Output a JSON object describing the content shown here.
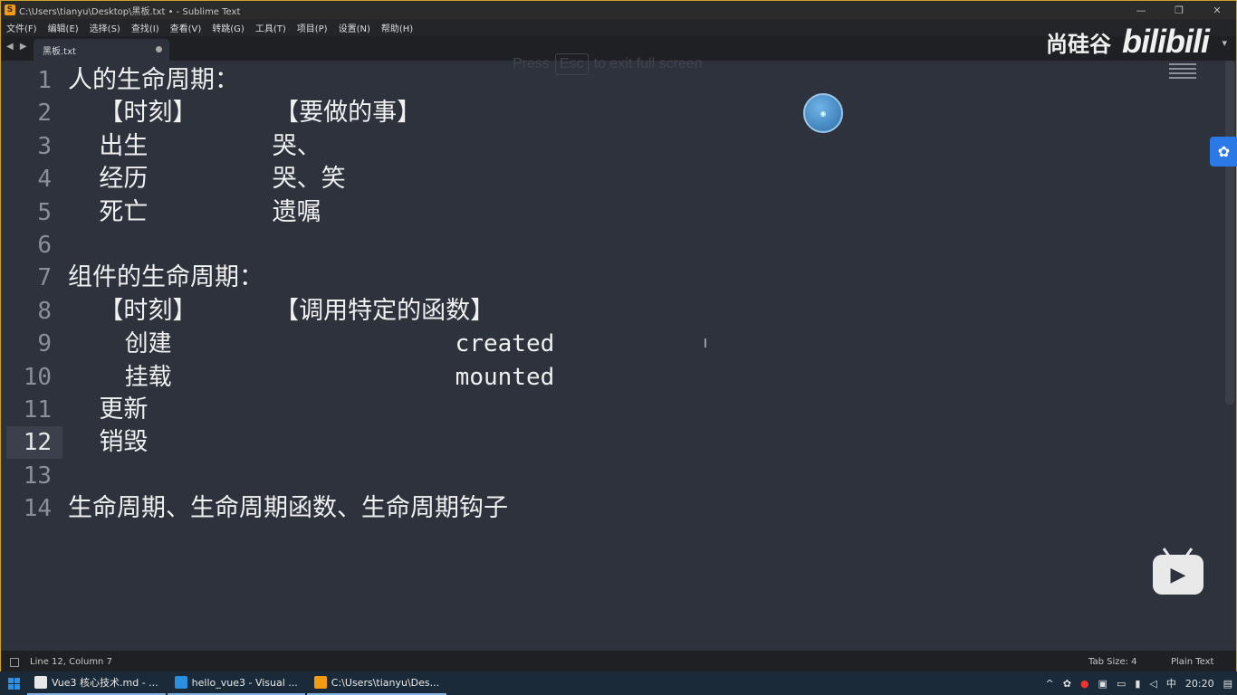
{
  "window": {
    "title": "C:\\Users\\tianyu\\Desktop\\黑板.txt • - Sublime Text",
    "controls": [
      "—",
      "❐",
      "✕"
    ]
  },
  "menu": [
    "文件(F)",
    "编辑(E)",
    "选择(S)",
    "查找(I)",
    "查看(V)",
    "转跳(G)",
    "工具(T)",
    "项目(P)",
    "设置(N)",
    "帮助(H)"
  ],
  "tab": {
    "label": "黑板.txt",
    "nav": "◀ ▶"
  },
  "overlay": {
    "press": "Press",
    "key": "Esc",
    "rest": "to exit full screen",
    "brand_cn": "尚硅谷",
    "brand_logo": "bilibili"
  },
  "editor": {
    "current_line": 12,
    "lines": [
      {
        "n": "1",
        "text": "人的生命周期："
      },
      {
        "n": "2",
        "text": "    【时刻】          【要做的事】"
      },
      {
        "n": "3",
        "text": "    出生                哭、"
      },
      {
        "n": "4",
        "text": "    经历                哭、笑"
      },
      {
        "n": "5",
        "text": "    死亡                遗嘱"
      },
      {
        "n": "6",
        "text": ""
      },
      {
        "n": "7",
        "text": "组件的生命周期："
      },
      {
        "n": "8",
        "text": "    【时刻】          【调用特定的函数】"
      },
      {
        "n": "9",
        "text": "    创建                    created"
      },
      {
        "n": "10",
        "text": "    挂载                    mounted"
      },
      {
        "n": "11",
        "text": "    更新"
      },
      {
        "n": "12",
        "text": "    销毁"
      },
      {
        "n": "13",
        "text": ""
      },
      {
        "n": "14",
        "text": "生命周期、生命周期函数、生命周期钩子"
      }
    ]
  },
  "status": {
    "position": "Line 12, Column 7",
    "tab_size": "Tab Size: 4",
    "syntax": "Plain Text"
  },
  "taskbar": {
    "items": [
      "Vue3 核心技术.md - ...",
      "hello_vue3 - Visual ...",
      "C:\\Users\\tianyu\\Des..."
    ],
    "tray_ime": "中",
    "clock": "20:20"
  },
  "colors": {
    "editor_bg": "#2d323d",
    "accent_border": "#c9a227",
    "side_button": "#2b79e6"
  }
}
